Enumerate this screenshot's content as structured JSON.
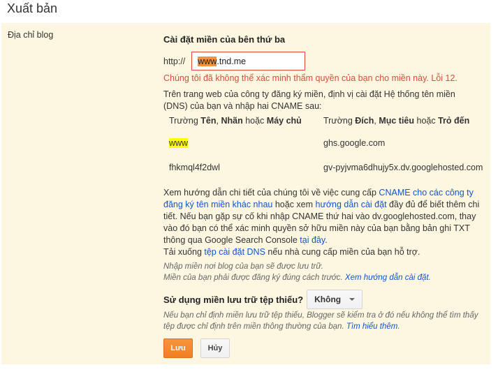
{
  "page": {
    "title": "Xuất bản"
  },
  "section": {
    "label": "Địa chỉ blog",
    "heading": "Cài đặt miền của bên thứ ba",
    "url_prefix": "http://",
    "input_highlight": "www",
    "input_rest": ".tnd.me",
    "error": "Chúng tôi đã không thể xác minh thẩm quyền của bạn cho miền này. Lỗi 12.",
    "instructions": "Trên trang web của công ty đăng ký miền, định vị cài đặt Hệ thống tên miền (DNS) của bạn và nhập hai CNAME sau:"
  },
  "cname": {
    "col1_prefix": "Trường ",
    "col1_b1": "Tên",
    "col1_sep1": ", ",
    "col1_b2": "Nhãn",
    "col1_sep2": " hoặc ",
    "col1_b3": "Máy chủ",
    "col2_prefix": "Trường ",
    "col2_b1": "Đích",
    "col2_sep1": ", ",
    "col2_b2": "Mục tiêu",
    "col2_sep2": " hoặc ",
    "col2_b3": "Trỏ đến",
    "rows": [
      {
        "name": "www",
        "target": "ghs.google.com"
      },
      {
        "name": "fhkmql4f2dwl",
        "target": "gv-pyjvma6dhujy5x.dv.googlehosted.com"
      }
    ]
  },
  "help": {
    "t1": "Xem hướng dẫn chi tiết của chúng tôi về việc cung cấp ",
    "link1": "CNAME cho các công ty đăng ký tên miền khác nhau",
    "t2": " hoặc xem ",
    "link2": "hướng dẫn cài đặt",
    "t3": " đầy đủ để biết thêm chi tiết. Nếu bạn gặp sự cố khi nhập CNAME thứ hai vào dv.googlehosted.com, thay vào đó bạn có thể xác minh quyền sở hữu miền này của bạn bằng bản ghi TXT thông qua Google Search Console ",
    "link3": "tại đây",
    "t4": ".",
    "t5": "Tải xuống ",
    "link4": "tệp cài đặt DNS",
    "t6": " nếu nhà cung cấp miền của bạn hỗ trợ."
  },
  "note": {
    "line1": "Nhập miền nơi blog của bạn sẽ được lưu trữ.",
    "line2": "Miền của bạn phải được đăng ký đúng cách trước. ",
    "link": "Xem hướng dẫn cài đặt",
    "end": "."
  },
  "naked": {
    "label": "Sử dụng miền lưu trữ tệp thiếu?",
    "selected": "Không",
    "note": "Nếu bạn chỉ định miền lưu trữ tệp thiếu, Blogger sẽ kiểm tra ở đó nếu không thể tìm thấy tệp được chỉ định trên miền thông thường của bạn. ",
    "link": "Tìm hiểu thêm",
    "end": "."
  },
  "buttons": {
    "save": "Lưu",
    "cancel": "Hủy"
  },
  "colors": {
    "error": "#dd4b39",
    "link": "#1155cc",
    "panel": "#fdf7e1",
    "save": "#f08022"
  }
}
